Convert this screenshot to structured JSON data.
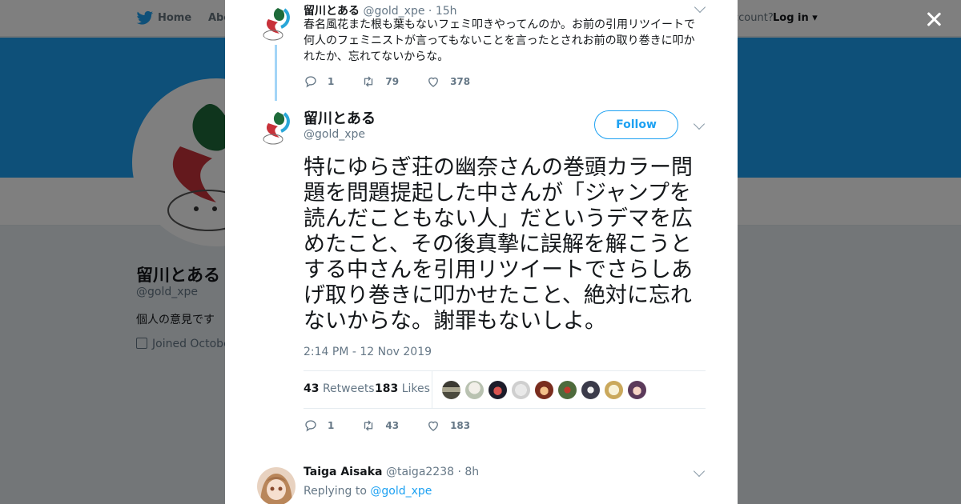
{
  "nav": {
    "home": "Home",
    "about": "Abo",
    "account_prompt": "ccount?",
    "login": "Log in"
  },
  "profile": {
    "name": "留川とある",
    "handle": "@gold_xpe",
    "bio": "個人の意見です",
    "joined": "Joined Octobe"
  },
  "thread_tweet": {
    "name": "留川とある",
    "handle": "@gold_xpe",
    "time": "· 15h",
    "text": "春名風花また根も葉もないフェミ叩きやってんのか。お前の引用リツイートで何人のフェミニストが言ってもないことを言ったとされお前の取り巻きに叩かれたか、忘れてないからな。",
    "replies": "1",
    "retweets": "79",
    "likes": "378"
  },
  "main_tweet": {
    "name": "留川とある",
    "handle": "@gold_xpe",
    "follow_label": "Follow",
    "text": "特にゆらぎ荘の幽奈さんの巻頭カラー問題を問題提起した中さんが「ジャンプを読んだこともない人」だというデマを広めたこと、その後真摯に誤解を解こうとする中さんを引用リツイートでさらしあげ取り巻きに叩かせたこと、絶対に忘れないからな。謝罪もないしよ。",
    "timestamp": "2:14 PM - 12 Nov 2019",
    "retweet_count": "43",
    "retweet_label": "Retweets",
    "like_count": "183",
    "like_label": "Likes",
    "replies": "1",
    "retweets": "43",
    "likes": "183"
  },
  "reply_tweet": {
    "name": "Taiga Aisaka",
    "handle": "@taiga2238",
    "time": "· 8h",
    "replying_prefix": "Replying to",
    "replying_handle": "@gold_xpe"
  },
  "icons": {
    "close": "close-icon",
    "twitter": "twitter-bird-icon",
    "reply": "reply-icon",
    "retweet": "retweet-icon",
    "like": "heart-icon",
    "caret": "chevron-down-icon",
    "calendar": "calendar-icon"
  },
  "colors": {
    "brand": "#1da1f2",
    "text": "#14171a",
    "muted": "#657786",
    "overlay": "rgba(0,0,0,0.5)"
  }
}
